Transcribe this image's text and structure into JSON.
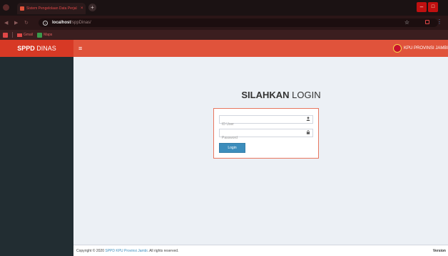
{
  "browser": {
    "tab_title": "Sistem Pengelolaan Data Perjal",
    "tab_close": "×",
    "new_tab": "+",
    "minimize": "–",
    "restore": "□",
    "url_host": "localhost",
    "url_path": "/sppDinas/",
    "star": "☆",
    "menu": "⋮",
    "bookmarks": [
      {
        "label": "Gmail"
      },
      {
        "label": "Maps"
      }
    ]
  },
  "header": {
    "logo_bold": "SPPD",
    "logo_rest": " DINAS",
    "hamburger": "≡",
    "user_name": "KPU PROVINSI JAMBI"
  },
  "login": {
    "title_bold": "SILAHKAN",
    "title_rest": " LOGIN",
    "user_placeholder": "ID User",
    "password_placeholder": "Password",
    "button_label": "Login"
  },
  "footer": {
    "copyright_prefix": "Copyright © 2020 ",
    "copyright_link": "SPPD KPU Provinsi Jambi",
    "copyright_suffix": ". All rights reserved.",
    "version_label": "Version"
  },
  "colors": {
    "header": "#e0533b",
    "logo_bg": "#d73925",
    "sidebar": "#222d32",
    "content_bg": "#ecf0f5",
    "button": "#3c8dbc"
  }
}
